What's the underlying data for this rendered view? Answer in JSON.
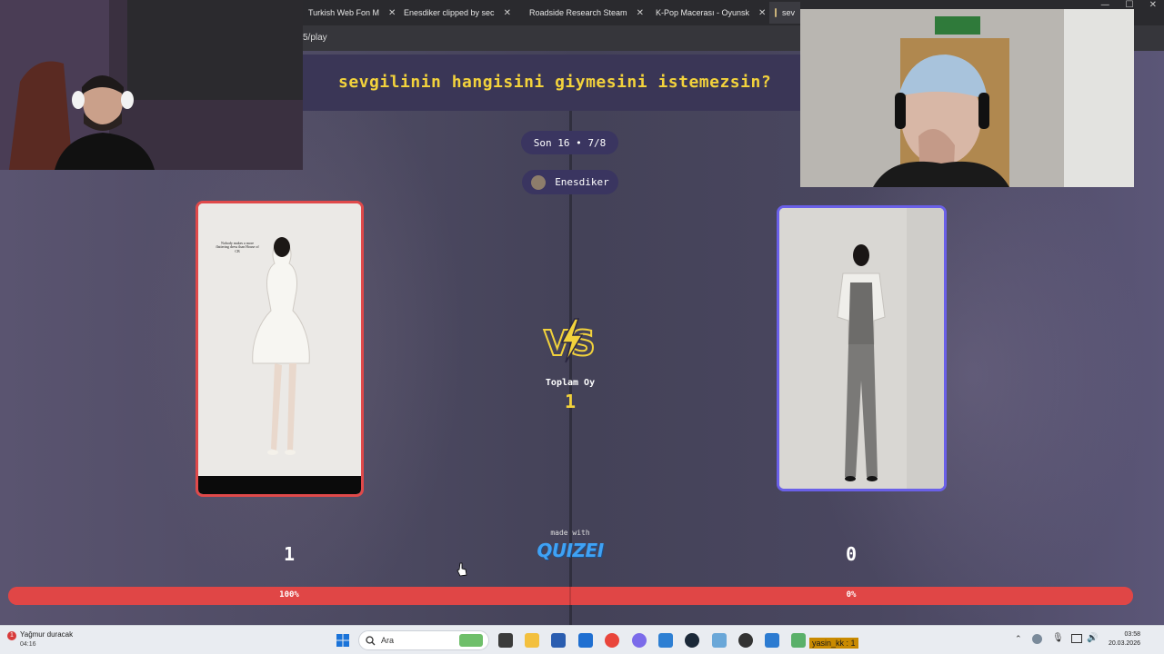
{
  "browser": {
    "tabs": [
      {
        "label": "Turkish Web Fon M",
        "color": "#8aa0d8"
      },
      {
        "label": "Enesdiker clipped by sec",
        "color": "#8fd14f"
      },
      {
        "label": "Roadside Research Steam",
        "color": "#1b2838"
      },
      {
        "label": "K-Pop Macerası - Oyunsk",
        "color": "#e06c6c"
      },
      {
        "label": "sev",
        "color": "#c9b27a"
      }
    ],
    "url": "5/play"
  },
  "quiz": {
    "question": "sevgilinin hangisini giymesini istemezsin?",
    "round": "Son 16 • 7/8",
    "player": "Enesdiker",
    "left_caption": "Nobody makes a more flattering dress than House of CB",
    "total_votes_label": "Toplam Oy",
    "total_votes": "1",
    "made_with": "made with",
    "brand": "QUIZEI",
    "left_score": "1",
    "right_score": "0",
    "left_percent": "100%",
    "right_percent": "0%",
    "left_fraction": 1.0,
    "colors": {
      "accent": "#f2d23c",
      "left_border": "#e0494a",
      "right_border": "#6a60e8",
      "bar": "#e04646"
    }
  },
  "taskbar": {
    "weather_title": "Yağmur duracak",
    "weather_time": "04:16",
    "weather_badge": "1",
    "search_label": "Ara",
    "chat_notice": "yasin_kk : 1",
    "time": "03:58",
    "date": "20.03.2026"
  }
}
